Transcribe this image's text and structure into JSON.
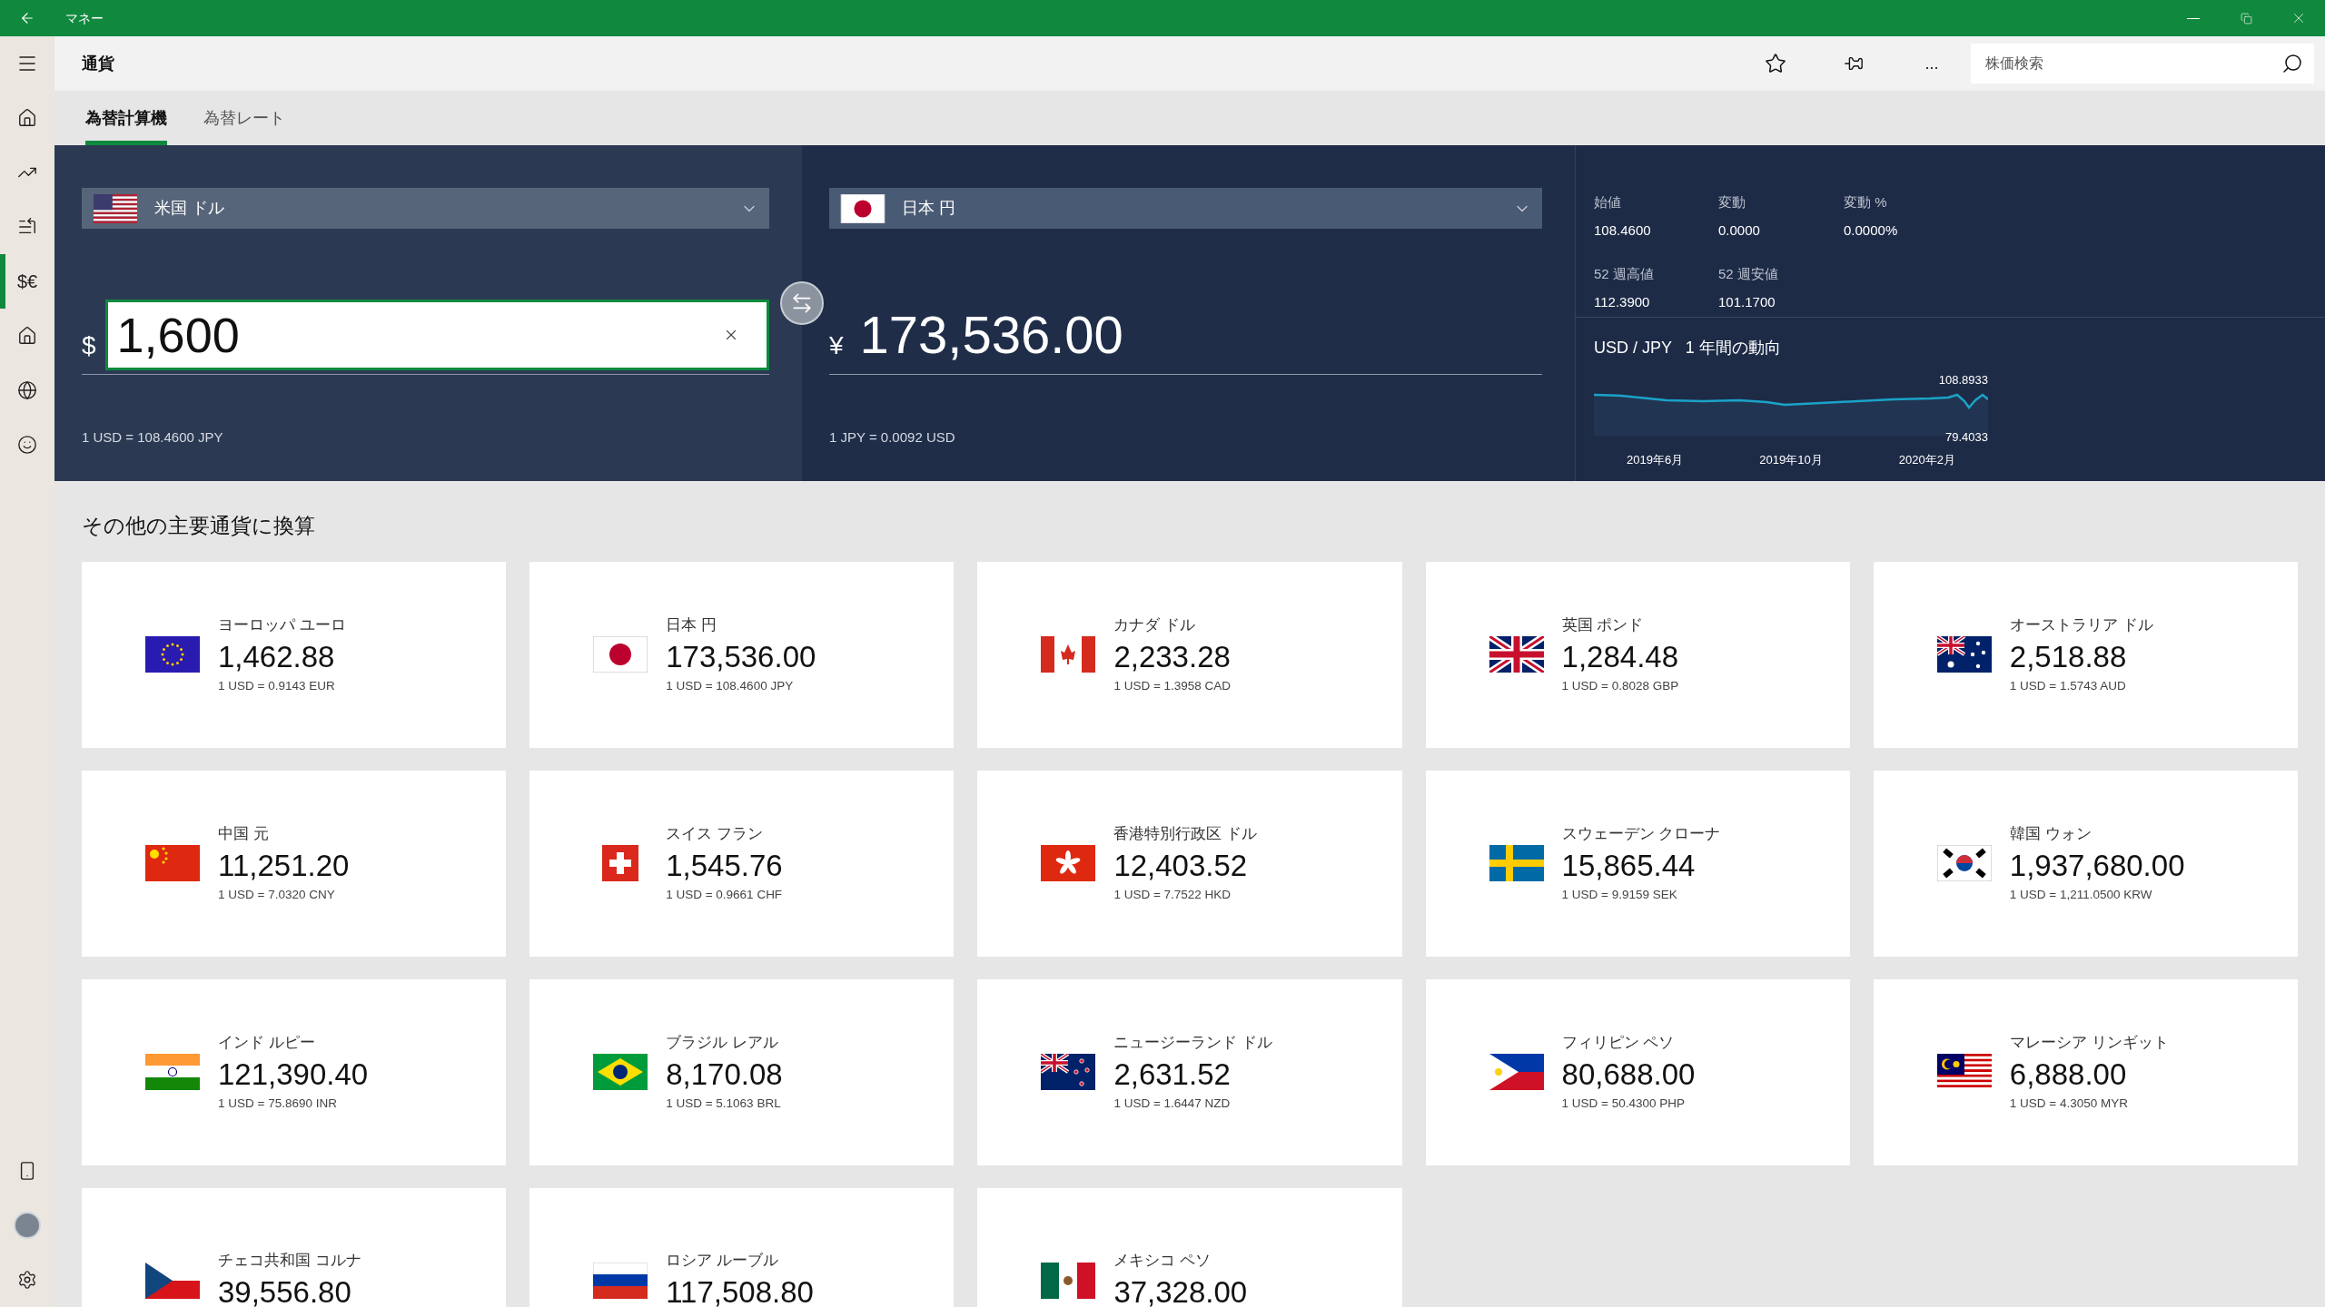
{
  "window": {
    "title": "マネー"
  },
  "sidebar": {
    "items": [
      {
        "kind": "home",
        "selected": false
      },
      {
        "kind": "trend",
        "selected": false
      },
      {
        "kind": "watchlist",
        "selected": false
      },
      {
        "kind": "currency",
        "label": "$€",
        "selected": true
      },
      {
        "kind": "mortgage",
        "selected": false
      },
      {
        "kind": "world",
        "selected": false
      },
      {
        "kind": "smiley",
        "selected": false
      }
    ],
    "bottom": [
      {
        "kind": "phone"
      },
      {
        "kind": "avatar"
      },
      {
        "kind": "settings"
      }
    ]
  },
  "header": {
    "title": "通貨",
    "more": "...",
    "search": {
      "placeholder": "株価検索"
    }
  },
  "tabs": [
    {
      "label": "為替計算機",
      "selected": true
    },
    {
      "label": "為替レート",
      "selected": false
    }
  ],
  "converter": {
    "from": {
      "kind": "us",
      "currency": "米国 ドル",
      "symbol": "$",
      "value": "1,600",
      "rate": "1 USD = 108.4600 JPY"
    },
    "to": {
      "kind": "jp",
      "currency": "日本 円",
      "symbol": "¥",
      "value": "173,536.00",
      "rate": "1 JPY = 0.0092 USD"
    }
  },
  "stats": [
    {
      "label": "始値",
      "value": "108.4600"
    },
    {
      "label": "変動",
      "value": "0.0000"
    },
    {
      "label": "変動 %",
      "value": "0.0000%"
    },
    {
      "label": "52 週高値",
      "value": "112.3900"
    },
    {
      "label": "52 週安値",
      "value": "101.1700"
    }
  ],
  "trend": {
    "title": "USD / JPY   1 年間の動向",
    "high": "108.8933",
    "low": "79.4033",
    "x_labels": [
      "2019年6月",
      "2019年10月",
      "2020年2月"
    ]
  },
  "others": {
    "title": "その他の主要通貨に換算",
    "cards": [
      {
        "kind": "eu",
        "name": "ヨーロッパ ユーロ",
        "value": "1,462.88",
        "rate": "1 USD = 0.9143 EUR"
      },
      {
        "kind": "jp",
        "name": "日本 円",
        "value": "173,536.00",
        "rate": "1 USD = 108.4600 JPY"
      },
      {
        "kind": "ca",
        "name": "カナダ ドル",
        "value": "2,233.28",
        "rate": "1 USD = 1.3958 CAD"
      },
      {
        "kind": "gb",
        "name": "英国 ポンド",
        "value": "1,284.48",
        "rate": "1 USD = 0.8028 GBP"
      },
      {
        "kind": "au",
        "name": "オーストラリア ドル",
        "value": "2,518.88",
        "rate": "1 USD = 1.5743 AUD"
      },
      {
        "kind": "cn",
        "name": "中国 元",
        "value": "11,251.20",
        "rate": "1 USD = 7.0320 CNY"
      },
      {
        "kind": "ch",
        "name": "スイス フラン",
        "value": "1,545.76",
        "rate": "1 USD = 0.9661 CHF"
      },
      {
        "kind": "hk",
        "name": "香港特別行政区 ドル",
        "value": "12,403.52",
        "rate": "1 USD = 7.7522 HKD"
      },
      {
        "kind": "se",
        "name": "スウェーデン クローナ",
        "value": "15,865.44",
        "rate": "1 USD = 9.9159 SEK"
      },
      {
        "kind": "kr",
        "name": "韓国 ウォン",
        "value": "1,937,680.00",
        "rate": "1 USD = 1,211.0500 KRW"
      },
      {
        "kind": "in",
        "name": "インド ルピー",
        "value": "121,390.40",
        "rate": "1 USD = 75.8690 INR"
      },
      {
        "kind": "br",
        "name": "ブラジル レアル",
        "value": "8,170.08",
        "rate": "1 USD = 5.1063 BRL"
      },
      {
        "kind": "nz",
        "name": "ニュージーランド ドル",
        "value": "2,631.52",
        "rate": "1 USD = 1.6447 NZD"
      },
      {
        "kind": "ph",
        "name": "フィリピン ペソ",
        "value": "80,688.00",
        "rate": "1 USD = 50.4300 PHP"
      },
      {
        "kind": "my",
        "name": "マレーシア リンギット",
        "value": "6,888.00",
        "rate": "1 USD = 4.3050 MYR"
      },
      {
        "kind": "cz",
        "name": "チェコ共和国 コルナ",
        "value": "39,556.80"
      },
      {
        "kind": "ru",
        "name": "ロシア ルーブル",
        "value": "117,508.80"
      },
      {
        "kind": "mx",
        "name": "メキシコ ペソ",
        "value": "37,328.00"
      }
    ]
  }
}
